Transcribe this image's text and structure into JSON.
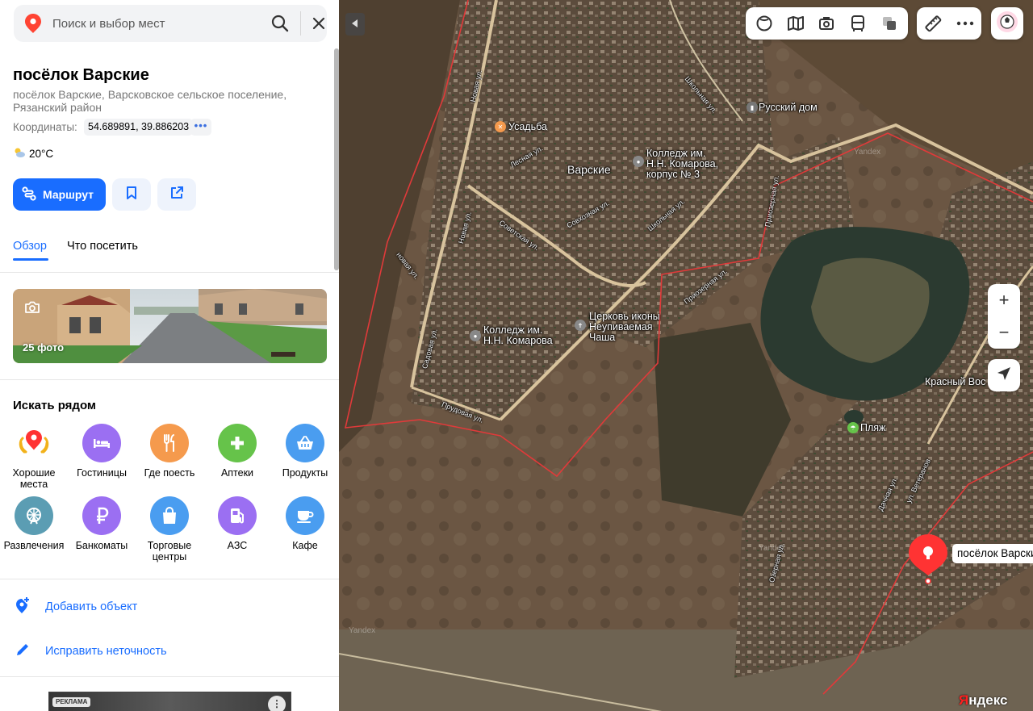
{
  "search": {
    "placeholder": "Поиск и выбор мест"
  },
  "place": {
    "title": "посёлок Варские",
    "subtitle": "посёлок Варские, Варсковское сельское поселение, Рязанский район",
    "coords_label": "Координаты:",
    "coords_value": "54.689891, 39.886203",
    "coords_more": "•••",
    "weather": "20°C"
  },
  "actions": {
    "route_label": "Маршрут"
  },
  "tabs": [
    {
      "label": "Обзор",
      "active": true
    },
    {
      "label": "Что посетить",
      "active": false
    }
  ],
  "photos": {
    "count_label": "25 фото"
  },
  "nearby": {
    "title": "Искать рядом",
    "categories": [
      {
        "label": "Хорошие места",
        "icon": "good-places-icon",
        "color": "#ffffff"
      },
      {
        "label": "Гостиницы",
        "icon": "hotel-icon",
        "color": "#9b6ff2"
      },
      {
        "label": "Где поесть",
        "icon": "food-icon",
        "color": "#f59a4d"
      },
      {
        "label": "Аптеки",
        "icon": "pharmacy-icon",
        "color": "#66c34a"
      },
      {
        "label": "Продукты",
        "icon": "groceries-icon",
        "color": "#4a9df0"
      },
      {
        "label": "Развлечения",
        "icon": "entertainment-icon",
        "color": "#5b9db3"
      },
      {
        "label": "Банкоматы",
        "icon": "atm-icon",
        "color": "#9b6ff2"
      },
      {
        "label": "Торговые центры",
        "icon": "mall-icon",
        "color": "#4a9df0"
      },
      {
        "label": "АЗС",
        "icon": "gas-station-icon",
        "color": "#9b6ff2"
      },
      {
        "label": "Кафе",
        "icon": "cafe-icon",
        "color": "#4a9df0"
      }
    ]
  },
  "links": {
    "add_object": "Добавить объект",
    "fix_error": "Исправить неточность"
  },
  "ad": {
    "label": "РЕКЛАМА",
    "more": "⋮"
  },
  "map": {
    "labels": {
      "russkiy_dom": "Русский дом",
      "usadba": "Усадьба",
      "kolledzh_korpus": "Колледж им.\nН.Н. Комарова,\nкорпус № 3",
      "varskie": "Варские",
      "tserkov": "Церковь иконы\nНеупиваемая\nЧаша",
      "kolledzh": "Колледж им.\nН.Н. Комарова",
      "krasny": "Красный Вос",
      "plyazh": "Пляж",
      "marker": "посёлок Варские"
    },
    "streets": {
      "novaya1": "Новая ул.",
      "novaya2": "Новая ул.",
      "novaya3": "новая ул.",
      "shkolnaya1": "Школьная ул.",
      "shkolnaya2": "Школьная ул.",
      "sovetskaya": "Советская ул.",
      "sovkhoznaya": "Совхозная ул.",
      "priozernaya1": "Приозерная ул.",
      "priozernaya2": "Приозерная ул.",
      "sadovaya": "Садовая ул.",
      "prudovaya": "Прудовая ул.",
      "lesnaya": "Лесная ул.",
      "ozernaya": "Озерная ул.",
      "dachnaya": "Дачная ул.",
      "veteranov": "ул. Ветеранов"
    },
    "watermark": "Yandex",
    "logo_prefix": "Я",
    "logo_rest": "ндекс",
    "zoom_in": "+",
    "zoom_out": "−"
  }
}
